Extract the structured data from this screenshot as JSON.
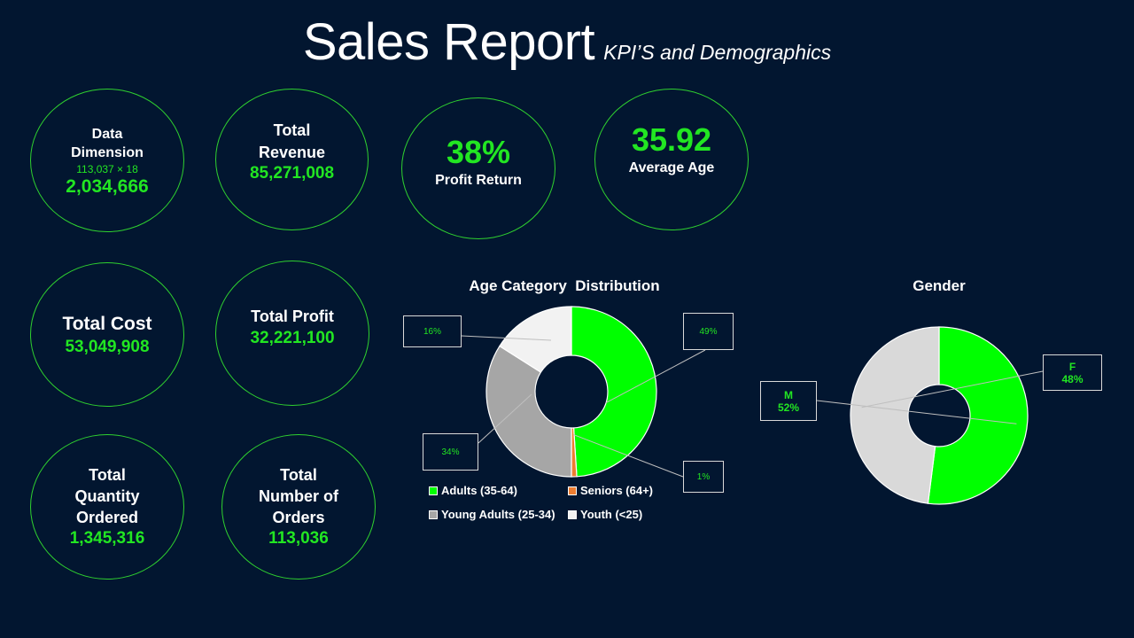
{
  "header": {
    "title": "Sales Report",
    "subtitle": "KPI’S and Demographics"
  },
  "kpis": {
    "data_dimension": {
      "label_line1": "Data",
      "label_line2": "Dimension",
      "detail": "113,037 × 18",
      "value": "2,034,666"
    },
    "total_revenue": {
      "label_line1": "Total",
      "label_line2": "Revenue",
      "value": "85,271,008"
    },
    "profit_return": {
      "value": "38%",
      "label": "Profit Return"
    },
    "average_age": {
      "value": "35.92",
      "label": "Average Age"
    },
    "total_cost": {
      "label": "Total Cost",
      "value": "53,049,908"
    },
    "total_profit": {
      "label": "Total  Profit",
      "value": "32,221,100"
    },
    "total_quantity": {
      "label_line1": "Total",
      "label_line2": "Quantity",
      "label_line3": "Ordered",
      "value": "1,345,316"
    },
    "total_orders": {
      "label_line1": "Total",
      "label_line2": "Number of",
      "label_line3": "Orders",
      "value": "113,036"
    }
  },
  "colors": {
    "background": "#021630",
    "accent_green": "#22e622",
    "slice_green": "#00ff00",
    "slice_orange": "#ed7d31",
    "slice_gray_dark": "#a6a6a6",
    "slice_gray_light": "#f2f2f2",
    "slice_gray_gender": "#d9d9d9"
  },
  "chart_data": [
    {
      "type": "pie",
      "title": "Age Category  Distribution",
      "categories": [
        "Adults (35-64)",
        "Seniors (64+)",
        "Young Adults (25-34)",
        "Youth (<25)"
      ],
      "values": [
        49,
        1,
        34,
        16
      ],
      "labels": [
        "49%",
        "1%",
        "34%",
        "16%"
      ],
      "colors": [
        "#00ff00",
        "#ed7d31",
        "#a6a6a6",
        "#f2f2f2"
      ],
      "legend": "bottom"
    },
    {
      "type": "pie",
      "title": "Gender",
      "categories": [
        "M",
        "F"
      ],
      "values": [
        52,
        48
      ],
      "labels": [
        "52%",
        "48%"
      ],
      "colors": [
        "#00ff00",
        "#d9d9d9"
      ],
      "legend": "none"
    }
  ]
}
